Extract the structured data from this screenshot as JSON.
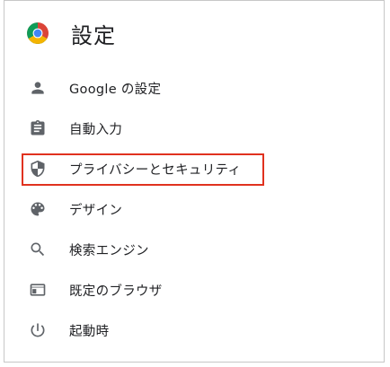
{
  "header": {
    "title": "設定",
    "logo_icon": "chrome-logo-icon"
  },
  "sidebar": {
    "items": [
      {
        "label": "Google の設定",
        "icon": "person-icon"
      },
      {
        "label": "自動入力",
        "icon": "clipboard-icon"
      },
      {
        "label": "プライバシーとセキュリティ",
        "icon": "shield-icon",
        "highlighted": true
      },
      {
        "label": "デザイン",
        "icon": "palette-icon"
      },
      {
        "label": "検索エンジン",
        "icon": "search-icon"
      },
      {
        "label": "既定のブラウザ",
        "icon": "browser-window-icon"
      },
      {
        "label": "起動時",
        "icon": "power-icon"
      }
    ]
  },
  "colors": {
    "highlight_border": "#e0321f",
    "text": "#202124",
    "icon": "#5f6368",
    "frame_border": "#c7c7c7"
  }
}
